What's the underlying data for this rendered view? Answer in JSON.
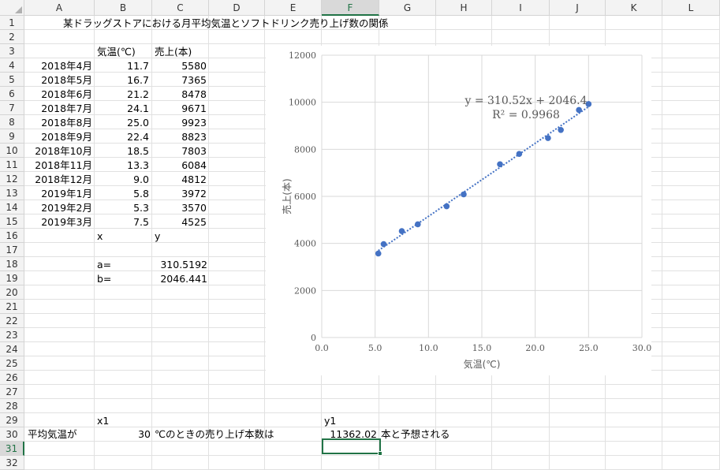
{
  "columns": [
    "A",
    "B",
    "C",
    "D",
    "E",
    "F",
    "G",
    "H",
    "I",
    "J",
    "K",
    "L"
  ],
  "selected_column": "F",
  "rows": [
    "1",
    "2",
    "3",
    "4",
    "5",
    "6",
    "7",
    "8",
    "9",
    "10",
    "11",
    "12",
    "13",
    "14",
    "15",
    "16",
    "17",
    "18",
    "19",
    "20",
    "21",
    "22",
    "23",
    "24",
    "25",
    "26",
    "27",
    "28",
    "29",
    "30",
    "31",
    "32"
  ],
  "selected_row": "31",
  "sheet": {
    "title": "某ドラッグストアにおける月平均気温とソフトドリンク売り上げ数の関係",
    "header_temp": "気温(℃)",
    "header_sales": "売上(本)",
    "table": [
      {
        "month": "2018年4月",
        "temp": "11.7",
        "sales": "5580"
      },
      {
        "month": "2018年5月",
        "temp": "16.7",
        "sales": "7365"
      },
      {
        "month": "2018年6月",
        "temp": "21.2",
        "sales": "8478"
      },
      {
        "month": "2018年7月",
        "temp": "24.1",
        "sales": "9671"
      },
      {
        "month": "2018年8月",
        "temp": "25.0",
        "sales": "9923"
      },
      {
        "month": "2018年9月",
        "temp": "22.4",
        "sales": "8823"
      },
      {
        "month": "2018年10月",
        "temp": "18.5",
        "sales": "7803"
      },
      {
        "month": "2018年11月",
        "temp": "13.3",
        "sales": "6084"
      },
      {
        "month": "2018年12月",
        "temp": "9.0",
        "sales": "4812"
      },
      {
        "month": "2019年1月",
        "temp": "5.8",
        "sales": "3972"
      },
      {
        "month": "2019年2月",
        "temp": "5.3",
        "sales": "3570"
      },
      {
        "month": "2019年3月",
        "temp": "7.5",
        "sales": "4525"
      }
    ],
    "x_label": "x",
    "y_label": "y",
    "a_label": "a=",
    "a_value": "310.5192",
    "b_label": "b=",
    "b_value": "2046.441",
    "x1_label": "x1",
    "y1_label": "y1",
    "avg_temp_text": "平均気温が",
    "x1_value": "30",
    "mid_text": "℃のときの売り上げ本数は",
    "y1_value": "11362.02",
    "end_text": "本と予想される"
  },
  "chart_data": {
    "type": "scatter",
    "xlabel": "気温(℃)",
    "ylabel": "売上(本)",
    "xlim": [
      0,
      30
    ],
    "ylim": [
      0,
      12000
    ],
    "xticks": [
      "0.0",
      "5.0",
      "10.0",
      "15.0",
      "20.0",
      "25.0",
      "30.0"
    ],
    "yticks": [
      "0",
      "2000",
      "4000",
      "6000",
      "8000",
      "10000",
      "12000"
    ],
    "x": [
      11.7,
      16.7,
      21.2,
      24.1,
      25.0,
      22.4,
      18.5,
      13.3,
      9.0,
      5.8,
      5.3,
      7.5
    ],
    "y": [
      5580,
      7365,
      8478,
      9671,
      9923,
      8823,
      7803,
      6084,
      4812,
      3972,
      3570,
      4525
    ],
    "trendline": {
      "slope": 310.52,
      "intercept": 2046.4,
      "x_range": [
        5.3,
        25.0
      ]
    },
    "equation": "y = 310.52x + 2046.4",
    "r_squared": "R² = 0.9968",
    "grid": true,
    "marker_color": "#4472C4"
  }
}
